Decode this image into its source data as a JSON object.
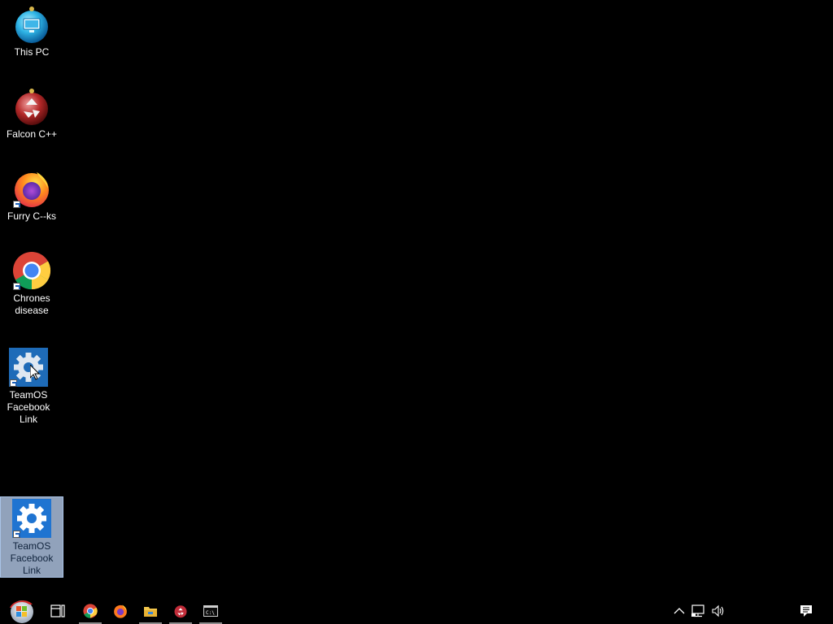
{
  "desktop": {
    "background_color": "#000000",
    "icons": [
      {
        "name": "this-pc",
        "label": "This PC",
        "icon": "monitor-icon"
      },
      {
        "name": "falcon-cpp",
        "label": "Falcon C++",
        "icon": "recycle-bin-icon"
      },
      {
        "name": "furry-c--ks",
        "label": "Furry C--ks",
        "icon": "firefox-icon"
      },
      {
        "name": "chrones-disease",
        "label": "Chrones disease",
        "icon": "chrome-icon"
      },
      {
        "name": "teamos-facebook-link-1",
        "label": "TeamOS Facebook Link",
        "icon": "gear-icon"
      },
      {
        "name": "teamos-facebook-link-2",
        "label": "TeamOS Facebook Link",
        "icon": "gear-icon",
        "selected": true
      }
    ]
  },
  "taskbar": {
    "start_icon": "windows-orb-icon",
    "pinned": [
      {
        "name": "task-view",
        "icon": "task-view-icon",
        "running": false
      },
      {
        "name": "chrome",
        "icon": "chrome-icon",
        "running": true
      },
      {
        "name": "firefox",
        "icon": "firefox-icon",
        "running": false
      },
      {
        "name": "file-explorer",
        "icon": "folder-icon",
        "running": true
      },
      {
        "name": "recycle-app",
        "icon": "recycle-icon",
        "running": true
      },
      {
        "name": "command-prompt",
        "icon": "terminal-icon",
        "running": true
      }
    ],
    "tray": [
      {
        "name": "show-hidden-icons",
        "icon": "chevron-up-icon"
      },
      {
        "name": "network",
        "icon": "network-icon"
      },
      {
        "name": "volume",
        "icon": "speaker-icon"
      }
    ],
    "action_center_icon": "notification-icon"
  }
}
